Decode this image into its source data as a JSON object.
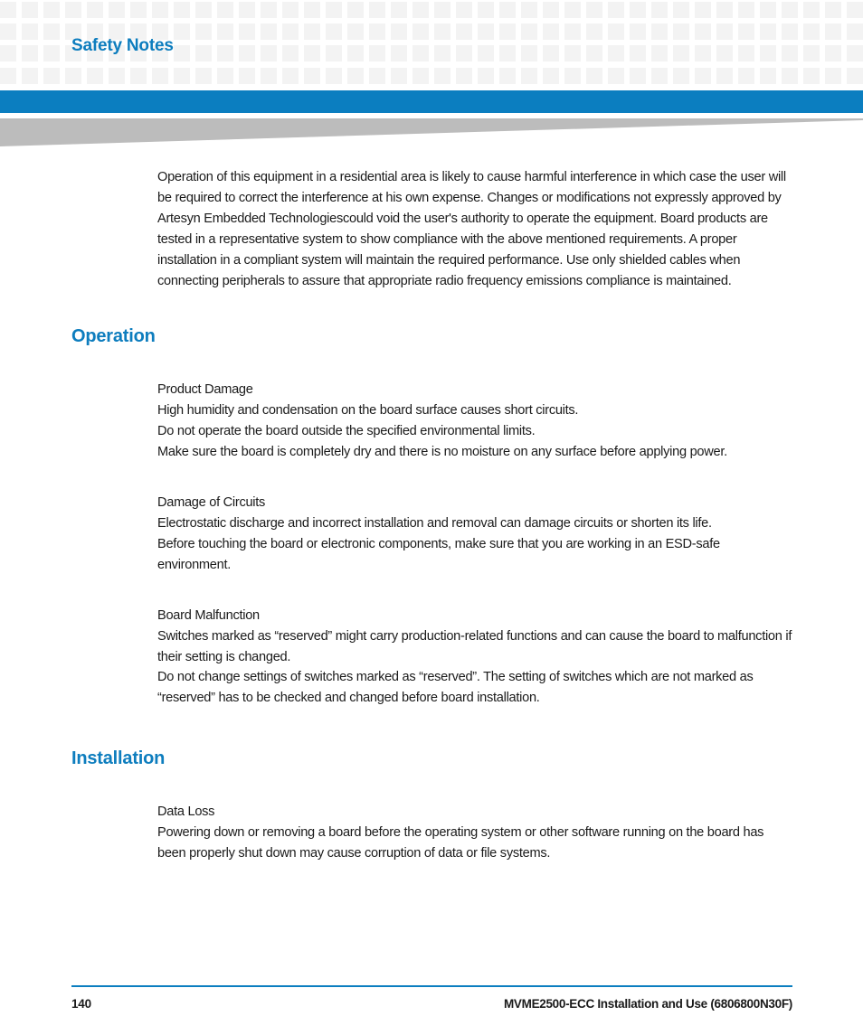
{
  "header": {
    "title": "Safety Notes",
    "accent_color": "#0d7dbe",
    "bar_color": "#0b7ec0",
    "swoosh_color": "#bcbcbc",
    "checker_color": "#f3f3f3"
  },
  "intro": {
    "paragraph": "Operation of this equipment in a residential area is likely to cause harmful interference in which case the user will be required to correct the interference at his own expense. Changes or modifications not expressly approved by Artesyn Embedded Technologiescould void the user's authority to operate the equipment. Board products are tested in a representative system to show compliance with the above mentioned requirements. A proper installation in a compliant system will maintain the required performance. Use only shielded cables when connecting peripherals to assure that appropriate radio frequency emissions compliance is maintained."
  },
  "sections": [
    {
      "heading": "Operation",
      "blocks": [
        {
          "title": "Product Damage",
          "lines": [
            "High humidity and condensation on the board surface causes short circuits.",
            "Do not operate the board outside the specified environmental limits.",
            "Make sure the board is completely dry and there is no moisture on any surface before applying power."
          ]
        },
        {
          "title": "Damage of Circuits",
          "lines": [
            "Electrostatic discharge and incorrect installation and removal can damage circuits or shorten its life.",
            "Before touching the board or electronic components, make sure that you are working in an ESD-safe environment."
          ]
        },
        {
          "title": "Board Malfunction",
          "lines": [
            "Switches marked as “reserved” might carry production-related functions and can cause the board to malfunction if their setting is changed.",
            "Do not change settings of switches marked as “reserved”. The setting of switches which are not marked as “reserved” has to be checked and changed before board installation."
          ]
        }
      ]
    },
    {
      "heading": "Installation",
      "blocks": [
        {
          "title": "Data Loss",
          "lines": [
            "Powering down or removing a board before the operating system or other software running on the board has been properly shut down may cause corruption of data or file systems."
          ]
        }
      ]
    }
  ],
  "footer": {
    "page_number": "140",
    "document_title": "MVME2500-ECC Installation and Use (6806800N30F)",
    "rule_color": "#0b7ec0"
  }
}
